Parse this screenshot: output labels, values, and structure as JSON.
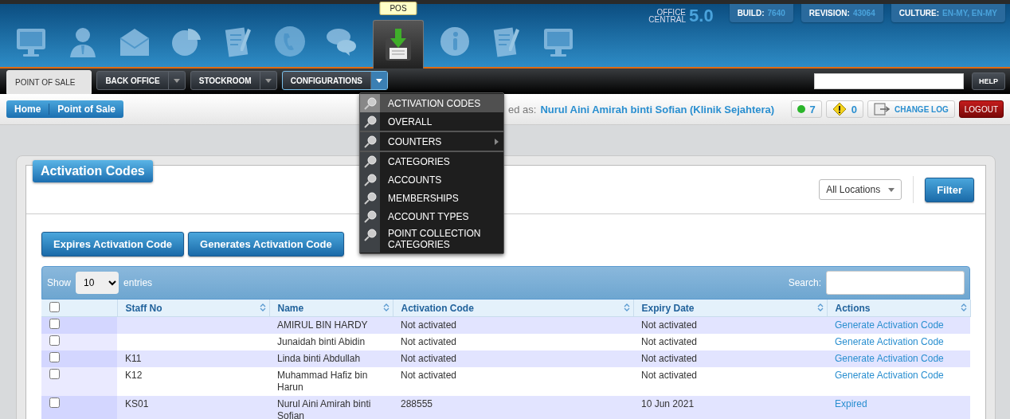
{
  "header": {
    "apps": [
      {
        "kind": "monitor",
        "selected": false
      },
      {
        "kind": "person",
        "selected": false
      },
      {
        "kind": "envelope",
        "selected": false
      },
      {
        "kind": "pie",
        "selected": false
      },
      {
        "kind": "document",
        "selected": false
      },
      {
        "kind": "phone",
        "selected": false
      },
      {
        "kind": "chat",
        "selected": false
      },
      {
        "kind": "pos",
        "selected": true,
        "tooltip": "POS"
      },
      {
        "kind": "info",
        "selected": false
      },
      {
        "kind": "document",
        "selected": false
      },
      {
        "kind": "monitor",
        "selected": false
      }
    ],
    "product": {
      "name_line_1": "OFFICE",
      "name_line_2": "CENTRAL",
      "version": "5.0"
    },
    "info_badges": [
      {
        "label": "BUILD:",
        "value": "7640"
      },
      {
        "label": "REVISION:",
        "value": "43064"
      },
      {
        "label": "CULTURE:",
        "value": "EN-MY, EN-MY"
      }
    ]
  },
  "nav": {
    "tabs": [
      {
        "label": "POINT OF SALE",
        "selected": true,
        "dropdown": false,
        "expanded": false
      },
      {
        "label": "BACK OFFICE",
        "selected": false,
        "dropdown": true,
        "expanded": false
      },
      {
        "label": "STOCKROOM",
        "selected": false,
        "dropdown": true,
        "expanded": false
      },
      {
        "label": "CONFIGURATIONS",
        "selected": false,
        "dropdown": true,
        "expanded": true
      }
    ],
    "help": "HELP"
  },
  "menu": {
    "groups": [
      [
        {
          "label": "ACTIVATION CODES",
          "selected": true,
          "submenu": false
        },
        {
          "label": "OVERALL",
          "selected": false,
          "submenu": false
        }
      ],
      [
        {
          "label": "COUNTERS",
          "selected": false,
          "submenu": true
        }
      ],
      [
        {
          "label": "CATEGORIES",
          "selected": false,
          "submenu": false
        },
        {
          "label": "ACCOUNTS",
          "selected": false,
          "submenu": false
        },
        {
          "label": "MEMBERSHIPS",
          "selected": false,
          "submenu": false
        },
        {
          "label": "ACCOUNT TYPES",
          "selected": false,
          "submenu": false
        },
        {
          "label": "POINT COLLECTION CATEGORIES",
          "selected": false,
          "submenu": false
        }
      ]
    ]
  },
  "breadcrumb": [
    "Home",
    "Point of Sale"
  ],
  "user_bar": {
    "logged_label": "ed as:",
    "user": "Nurul Aini Amirah binti Sofian (Klinik Sejahtera)",
    "online_count": "7",
    "warning_count": "0",
    "change_log": "CHANGE LOG",
    "logout": "LOGOUT"
  },
  "panel": {
    "title": "Activation Codes",
    "location": "All Locations",
    "filter": "Filter",
    "actions": [
      "Expires Activation Code",
      "Generates Activation Code"
    ],
    "table": {
      "show_label": "Show",
      "page_size": "10",
      "entries_label": "entries",
      "search_label": "Search:",
      "select_all_checked": false,
      "columns": [
        "Staff No",
        "Name",
        "Activation Code",
        "Expiry Date",
        "Actions"
      ],
      "rows": [
        {
          "checked": false,
          "staff_no": "",
          "name": "AMIRUL BIN HARDY",
          "code": "Not activated",
          "expiry": "Not activated",
          "action": "Generate Activation Code"
        },
        {
          "checked": false,
          "staff_no": "",
          "name": "Junaidah binti Abidin",
          "code": "Not activated",
          "expiry": "Not activated",
          "action": "Generate Activation Code"
        },
        {
          "checked": false,
          "staff_no": "K11",
          "name": "Linda binti Abdullah",
          "code": "Not activated",
          "expiry": "Not activated",
          "action": "Generate Activation Code"
        },
        {
          "checked": false,
          "staff_no": "K12",
          "name": "Muhammad Hafiz bin Harun",
          "code": "Not activated",
          "expiry": "Not activated",
          "action": "Generate Activation Code"
        },
        {
          "checked": false,
          "staff_no": "KS01",
          "name": "Nurul Aini Amirah binti Sofian",
          "code": "288555",
          "expiry": "10 Jun 2021",
          "action": "Expired"
        }
      ]
    }
  }
}
